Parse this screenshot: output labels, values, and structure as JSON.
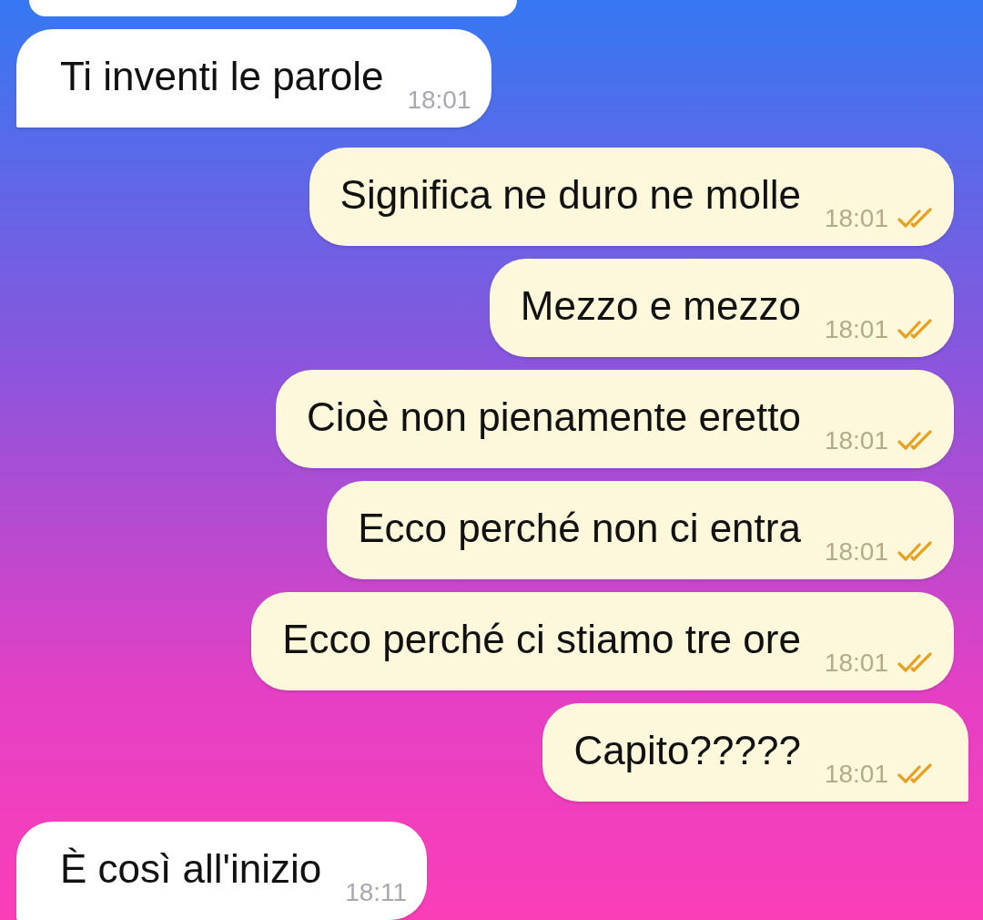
{
  "messages": [
    {
      "kind": "incoming",
      "text": "Ti inventi le parole",
      "time": "18:01"
    },
    {
      "kind": "outgoing",
      "text": "Significa ne duro ne molle",
      "time": "18:01",
      "read": true,
      "tail": false
    },
    {
      "kind": "outgoing",
      "text": "Mezzo e mezzo",
      "time": "18:01",
      "read": true,
      "tail": false
    },
    {
      "kind": "outgoing",
      "text": "Cioè non pienamente eretto",
      "time": "18:01",
      "read": true,
      "tail": false
    },
    {
      "kind": "outgoing",
      "text": "Ecco perché non ci entra",
      "time": "18:01",
      "read": true,
      "tail": false
    },
    {
      "kind": "outgoing",
      "text": "Ecco perché ci stiamo tre ore",
      "time": "18:01",
      "read": true,
      "tail": false
    },
    {
      "kind": "outgoing",
      "text": "Capito?????",
      "time": "18:01",
      "read": true,
      "tail": true
    },
    {
      "kind": "incoming",
      "text": "È così all'inizio",
      "time": "18:11"
    }
  ]
}
